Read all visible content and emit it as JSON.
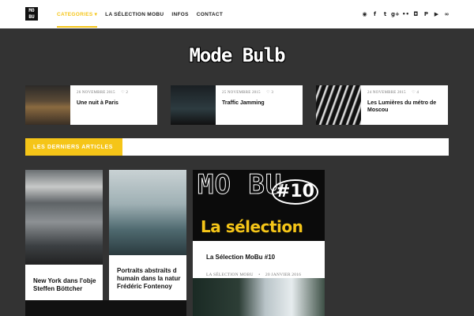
{
  "logo": {
    "text": "MO BU"
  },
  "nav": {
    "items": [
      {
        "label": "CATEGORIES ▾",
        "active": true
      },
      {
        "label": "LA SÉLECTION MOBU",
        "active": false
      },
      {
        "label": "INFOS",
        "active": false
      },
      {
        "label": "CONTACT",
        "active": false
      }
    ]
  },
  "socials": [
    {
      "icon": "rss-icon",
      "glyph": "◉"
    },
    {
      "icon": "facebook-icon",
      "glyph": "f"
    },
    {
      "icon": "twitter-icon",
      "glyph": "t"
    },
    {
      "icon": "google-plus-icon",
      "glyph": "g+"
    },
    {
      "icon": "flickr-icon",
      "glyph": "••"
    },
    {
      "icon": "instagram-icon",
      "glyph": "◘"
    },
    {
      "icon": "pinterest-icon",
      "glyph": "P"
    },
    {
      "icon": "youtube-icon",
      "glyph": "▶"
    },
    {
      "icon": "lastfm-icon",
      "glyph": "∞"
    }
  ],
  "site_title": "Mode Bulb",
  "featured": [
    {
      "date": "26 NOVEMBRE 2015",
      "likes": "2",
      "title": "Une nuit à Paris"
    },
    {
      "date": "25 NOVEMBRE 2015",
      "likes": "3",
      "title": "Traffic Jamming"
    },
    {
      "date": "24 NOVEMBRE 2015",
      "likes": "4",
      "title": "Les Lumières du métro de Moscou"
    }
  ],
  "section": {
    "label": "LES DERNIERS ARTICLES"
  },
  "articles": [
    {
      "title_line1": "New York dans l'obje",
      "title_line2": "Steffen Böttcher"
    },
    {
      "title_line1": "Portraits abstraits d",
      "title_line2": "humain dans la natur",
      "title_line3": "Frédéric Fontenoy"
    },
    {
      "title": "La Sélection MoBu #10",
      "category": "LA SÉLECTION MOBU",
      "date": "20 JANVIER 2016",
      "image_text": {
        "mobu": "MO BU",
        "number": "#10",
        "overlay": "La sélection"
      }
    }
  ],
  "colors": {
    "accent": "#f5c518",
    "background": "#333333"
  }
}
